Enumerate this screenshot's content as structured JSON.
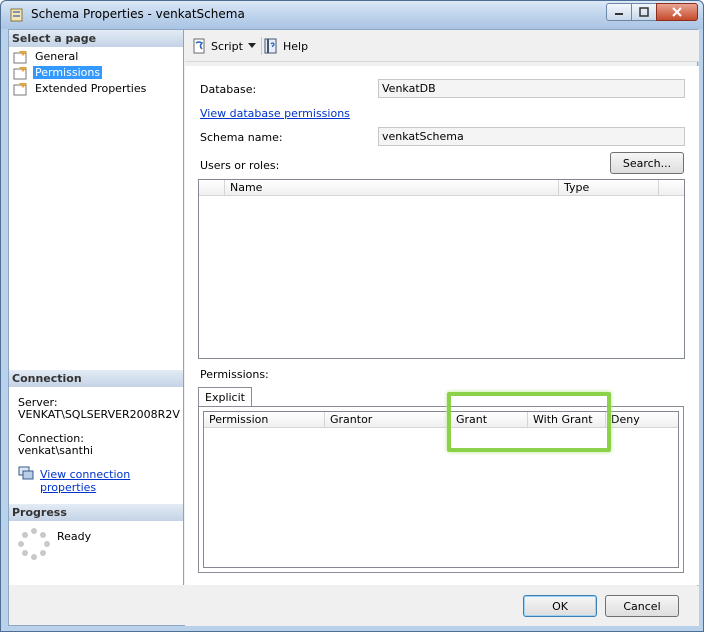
{
  "window": {
    "title": "Schema Properties - venkatSchema"
  },
  "left_pane": {
    "select_page_header": "Select a page",
    "pages": [
      {
        "label": "General"
      },
      {
        "label": "Permissions"
      },
      {
        "label": "Extended Properties"
      }
    ],
    "connection_header": "Connection",
    "server_label": "Server:",
    "server_value": "VENKAT\\SQLSERVER2008R2V",
    "connection_label": "Connection:",
    "connection_value": "venkat\\santhi",
    "view_connection_link": "View connection properties",
    "progress_header": "Progress",
    "progress_status": "Ready"
  },
  "toolbar": {
    "script_label": "Script",
    "help_label": "Help"
  },
  "form": {
    "database_label": "Database:",
    "database_value": "VenkatDB",
    "view_permissions_link": "View database permissions",
    "schema_name_label": "Schema name:",
    "schema_name_value": "venkatSchema",
    "users_roles_label": "Users or roles:",
    "search_button": "Search...",
    "users_columns": [
      "Name",
      "Type"
    ],
    "permissions_label": "Permissions:",
    "tab_explicit": "Explicit",
    "permission_columns": [
      "Permission",
      "Grantor",
      "Grant",
      "With Grant",
      "Deny"
    ]
  },
  "footer": {
    "ok_label": "OK",
    "cancel_label": "Cancel"
  },
  "colors": {
    "highlight": "#8bd14a",
    "selection": "#3399ff",
    "link": "#0033cc"
  }
}
